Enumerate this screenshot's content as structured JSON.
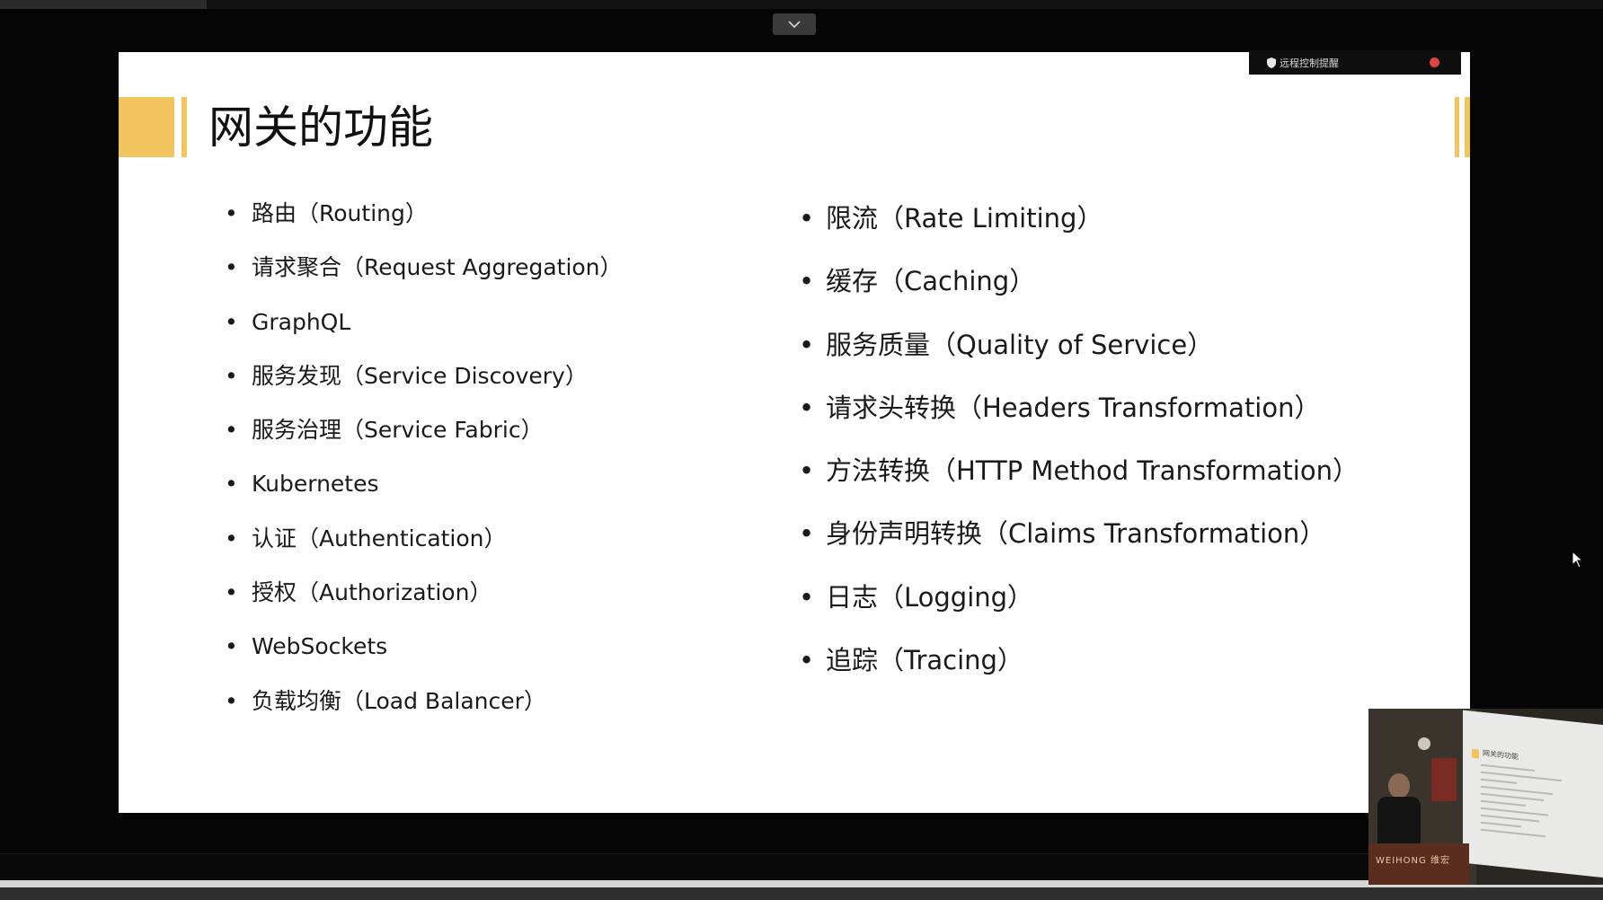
{
  "slide": {
    "title": "网关的功能",
    "left_column": [
      "路由（Routing）",
      "请求聚合（Request Aggregation）",
      "GraphQL",
      "服务发现（Service Discovery）",
      "服务治理（Service Fabric）",
      "Kubernetes",
      "认证（Authentication）",
      "授权（Authorization）",
      "WebSockets",
      "负载均衡（Load Balancer）"
    ],
    "right_column": [
      "限流（Rate Limiting）",
      "缓存（Caching）",
      "服务质量（Quality of Service）",
      "请求头转换（Headers Transformation）",
      "方法转换（HTTP Method Transformation）",
      "身份声明转换（Claims Transformation）",
      "日志（Logging）",
      "追踪（Tracing）"
    ]
  },
  "remote_control_banner": {
    "label": "远程控制提醒"
  },
  "camera_feed": {
    "podium_text": "WEIHONG 维宏"
  },
  "icons": {
    "toggle": "chevron-down-icon",
    "banner": "shield-icon",
    "cursor": "mouse-cursor-icon"
  },
  "colors": {
    "accent": "#f2c45e",
    "slide_background": "#ffffff",
    "screen_background": "#050505",
    "banner_close": "#e0443e"
  }
}
